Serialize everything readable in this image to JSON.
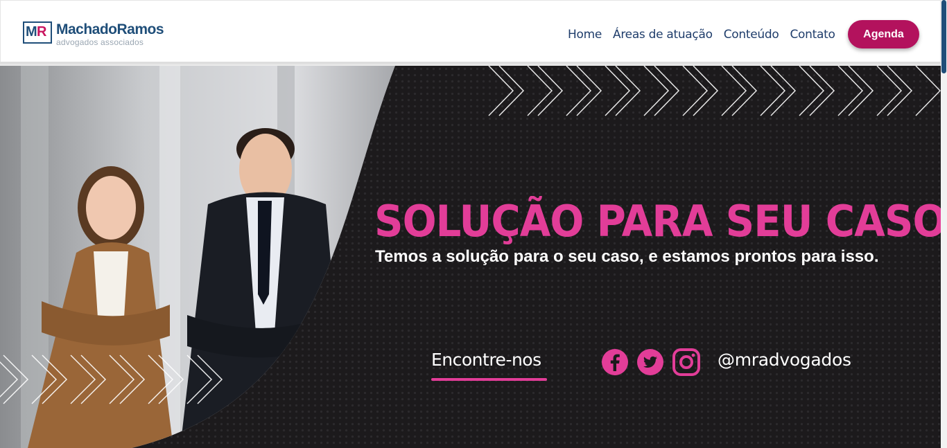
{
  "header": {
    "logo": {
      "mark_m": "M",
      "mark_r": "R",
      "name": "MachadoRamos",
      "subtitle": "advogados associados"
    },
    "nav": [
      "Home",
      "Áreas de atuação",
      "Conteúdo",
      "Contato"
    ],
    "cta_label": "Agenda"
  },
  "hero": {
    "headline": "SOLUÇÃO PARA SEU CASO!",
    "subheadline": "Temos a solução para o seu caso, e estamos prontos para isso.",
    "find_us_label": "Encontre-nos",
    "social_icons": [
      "facebook-icon",
      "twitter-icon",
      "instagram-icon"
    ],
    "social_handle": "@mradvogados"
  },
  "colors": {
    "brand_blue": "#1f4e79",
    "brand_pink": "#e23d98",
    "cta": "#b3125d",
    "hero_bg": "#1c1a1c"
  }
}
